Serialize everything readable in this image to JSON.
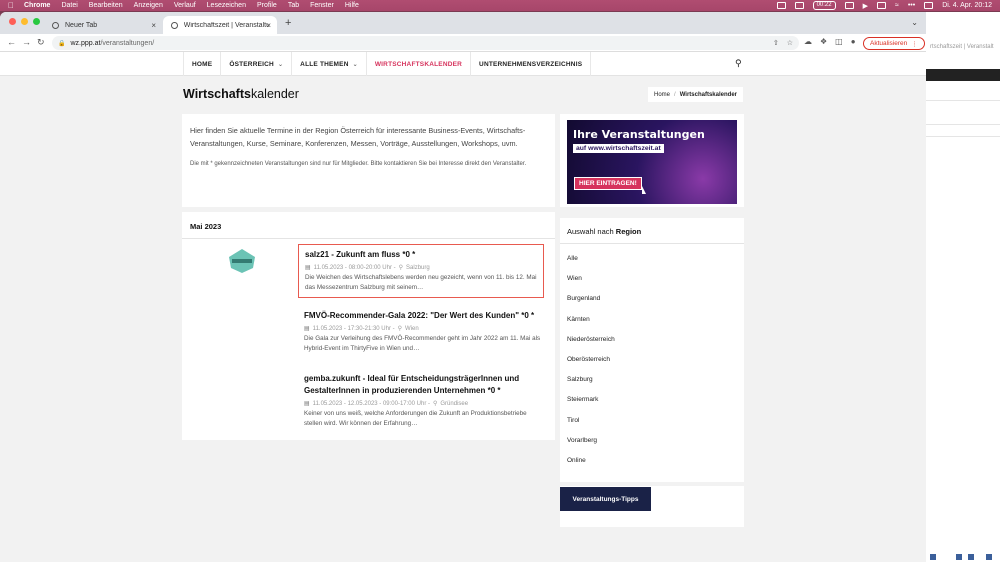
{
  "menubar": {
    "app": "Chrome",
    "items": [
      "Datei",
      "Bearbeiten",
      "Anzeigen",
      "Verlauf",
      "Lesezeichen",
      "Profile",
      "Tab",
      "Fenster",
      "Hilfe"
    ],
    "timer": "00:22",
    "clock": "Di. 4. Apr. 20:12"
  },
  "tabs": [
    {
      "title": "Neuer Tab"
    },
    {
      "title": "Wirtschaftszeit | Veranstaltungs"
    }
  ],
  "address": {
    "host": "wz.ppp.at",
    "path": "/veranstaltungen/"
  },
  "update_button": "Aktualisieren",
  "bg_window": {
    "title": "rtschaftszeit | Veranstalt"
  },
  "nav": {
    "items": [
      "HOME",
      "ÖSTERREICH",
      "ALLE THEMEN",
      "WIRTSCHAFTSKALENDER",
      "UNTERNEHMENSVERZEICHNIS"
    ],
    "active_color": "#d6335d"
  },
  "page": {
    "title_bold": "Wirtschafts",
    "title_rest": "kalender",
    "breadcrumb_home": "Home",
    "breadcrumb_current": "Wirtschaftskalender"
  },
  "intro": {
    "p1": "Hier finden Sie aktuelle Termine in der Region Österreich für interessante Business-Events, Wirtschafts-Veranstaltungen, Kurse, Seminare, Konferenzen, Messen, Vorträge, Ausstellungen, Workshops, uvm.",
    "p2": "Die mit * gekennzeichneten Veranstaltungen sind nur für Mitglieder. Bitte kontaktieren Sie bei Interesse direkt den Veranstalter."
  },
  "events": {
    "month": "Mai 2023",
    "items": [
      {
        "title": "salz21 - Zukunft am fluss *0 *",
        "date": "11.05.2023 - 08:00-20:00 Uhr -",
        "location": "Salzburg",
        "desc": "Die Weichen des Wirtschaftslebens werden neu gezeicht, wenn von 11. bis 12. Mai das Messezentrum Salzburg mit seinem…"
      },
      {
        "title": "FMVÖ-Recommender-Gala 2022: \"Der Wert des Kunden\" *0 *",
        "date": "11.05.2023 - 17:30-21:30 Uhr -",
        "location": "Wien",
        "desc": "Die Gala zur Verleihung des FMVÖ-Recommender geht im Jahr 2022 am 11. Mai als Hybrid-Event im ThirtyFive in Wien und…"
      },
      {
        "title": "gemba.zukunft - Ideal für EntscheidungsträgerInnen und GestalterInnen in produzierenden Unternehmen *0 *",
        "date": "11.05.2023 - 12.05.2023 - 09:00-17:00 Uhr -",
        "location": "Gründisee",
        "desc": "Keiner von uns weiß, welche Anforderungen die Zukunft an Produktionsbetriebe stellen wird. Wir können der Erfahrung…"
      }
    ]
  },
  "banner": {
    "headline": "Ihre Veranstaltungen",
    "url": "auf www.wirtschaftszeit.at",
    "cta": "HIER EINTRAGEN!"
  },
  "region": {
    "heading_prefix": "Auswahl nach ",
    "heading_bold": "Region",
    "items": [
      "Alle",
      "Wien",
      "Burgenland",
      "Kärnten",
      "Niederösterreich",
      "Oberösterreich",
      "Salzburg",
      "Steiermark",
      "Tirol",
      "Vorarlberg",
      "Online"
    ]
  },
  "tipps_button": "Veranstaltungs-Tipps"
}
